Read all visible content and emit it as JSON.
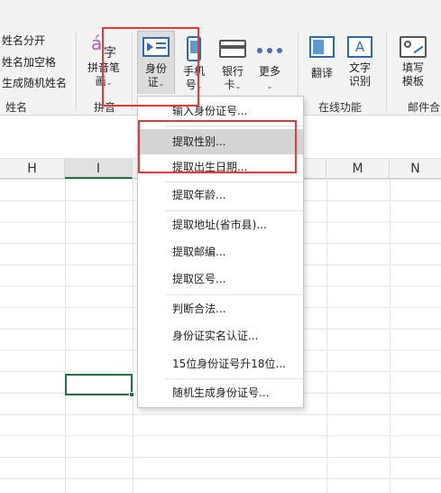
{
  "ribbon": {
    "name_group": {
      "items": [
        "姓名分开",
        "姓名加空格",
        "生成随机姓名"
      ],
      "label": "姓名"
    },
    "pinyin_group": {
      "button": {
        "icon_char": "á",
        "icon_char2": "字",
        "line1": "拼音笔",
        "line2": "画"
      },
      "label": "拼音"
    },
    "id_group": {
      "id_button": {
        "line1": "身份",
        "line2": "证"
      },
      "phone_button": {
        "line1": "手机",
        "line2": "号"
      },
      "bank_button": {
        "line1": "银行",
        "line2": "卡"
      },
      "more_button": {
        "line1": "更多"
      }
    },
    "online_group": {
      "translate_button": {
        "line1": "翻译"
      },
      "ocr_button": {
        "line1": "文字",
        "line2": "识别",
        "icon_char": "A"
      },
      "label": "在线功能"
    },
    "mail_group": {
      "template_button": {
        "line1": "填写",
        "line2": "模板"
      },
      "label": "邮件合"
    },
    "caret": "⌄"
  },
  "sheet": {
    "columns": [
      "H",
      "I",
      "M",
      "N"
    ],
    "active_column": "I"
  },
  "id_menu": {
    "items": [
      "输入身份证号...",
      "提取性别...",
      "提取出生日期...",
      "提取年龄...",
      "提取地址(省市县)...",
      "提取邮编...",
      "提取区号...",
      "判断合法...",
      "身份证实名认证...",
      "15位身份证号升18位...",
      "随机生成身份证号..."
    ],
    "highlighted": "提取性别..."
  },
  "colors": {
    "accent_green": "#1e7145",
    "annotation_red": "#e53935",
    "icon_blue": "#2b6cb0",
    "pinyin_purple": "#b35ab8"
  }
}
